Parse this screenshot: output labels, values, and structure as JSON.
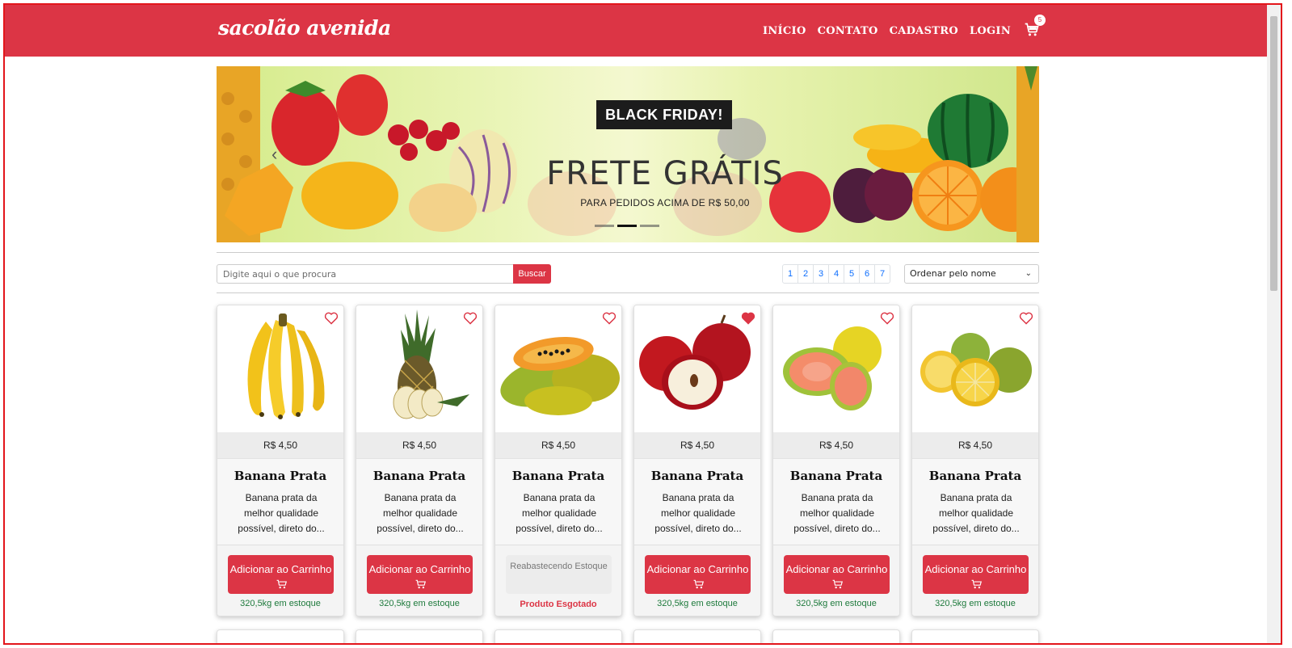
{
  "navbar": {
    "brand": "sacolão avenida",
    "links": [
      "INÍCIO",
      "CONTATO",
      "CADASTRO",
      "LOGIN"
    ],
    "cart_count": "5",
    "cart_icon": "cart-icon",
    "color": "#dc3545"
  },
  "banner": {
    "badge": "BLACK FRIDAY!",
    "headline": "FRETE GRÁTIS",
    "subline": "PARA PEDIDOS ACIMA DE R$ 50,00",
    "slides": 3,
    "active_slide": 2
  },
  "search": {
    "placeholder": "Digite aqui o que procura",
    "button": "Buscar"
  },
  "pagination": [
    "1",
    "2",
    "3",
    "4",
    "5",
    "6",
    "7"
  ],
  "sort": {
    "selected": "Ordenar pelo nome"
  },
  "products": [
    {
      "fruit": "banana",
      "price": "R$ 4,50",
      "title": "Banana Prata",
      "desc": "Banana prata da melhor qualidade possível, direto do...",
      "button": "Adicionar ao Carrinho",
      "stock": "320,5kg em estoque",
      "favorite": false,
      "sold_out": false
    },
    {
      "fruit": "pineapple",
      "price": "R$ 4,50",
      "title": "Banana Prata",
      "desc": "Banana prata da melhor qualidade possível, direto do...",
      "button": "Adicionar ao Carrinho",
      "stock": "320,5kg em estoque",
      "favorite": false,
      "sold_out": false
    },
    {
      "fruit": "papaya",
      "price": "R$ 4,50",
      "title": "Banana Prata",
      "desc": "Banana prata da melhor qualidade possível, direto do...",
      "restock": "Reabastecendo Estoque",
      "status": "Produto Esgotado",
      "favorite": false,
      "sold_out": true
    },
    {
      "fruit": "apple",
      "price": "R$ 4,50",
      "title": "Banana Prata",
      "desc": "Banana prata da melhor qualidade possível, direto do...",
      "button": "Adicionar ao Carrinho",
      "stock": "320,5kg em estoque",
      "favorite": true,
      "sold_out": false
    },
    {
      "fruit": "guava",
      "price": "R$ 4,50",
      "title": "Banana Prata",
      "desc": "Banana prata da melhor qualidade possível, direto do...",
      "button": "Adicionar ao Carrinho",
      "stock": "320,5kg em estoque",
      "favorite": false,
      "sold_out": false
    },
    {
      "fruit": "orange",
      "price": "R$ 4,50",
      "title": "Banana Prata",
      "desc": "Banana prata da melhor qualidade possível, direto do...",
      "button": "Adicionar ao Carrinho",
      "stock": "320,5kg em estoque",
      "favorite": false,
      "sold_out": false
    }
  ]
}
